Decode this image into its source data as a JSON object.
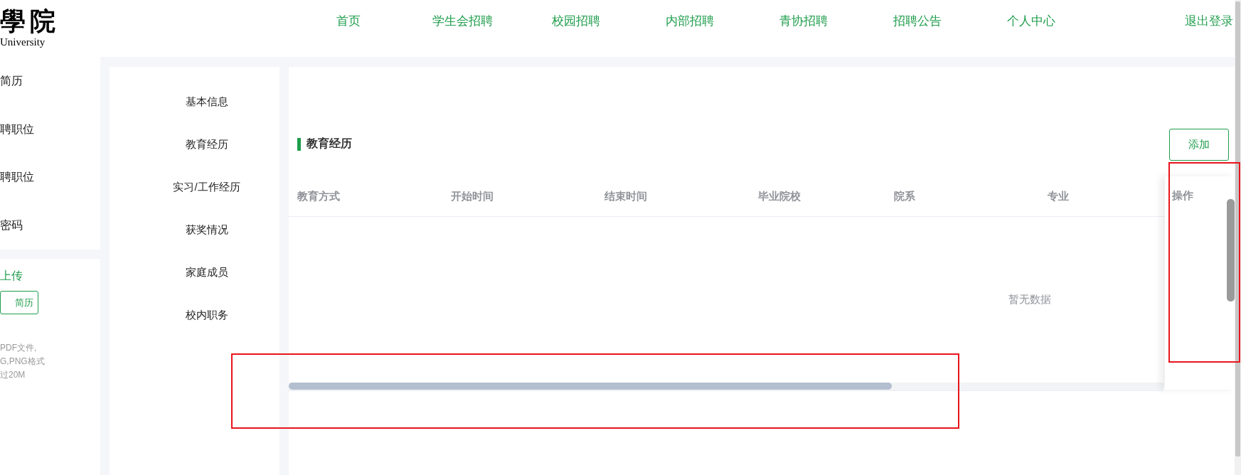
{
  "header": {
    "logo": {
      "mark": "學院",
      "subtitle": "University"
    },
    "nav": [
      {
        "label": "首页"
      },
      {
        "label": "学生会招聘"
      },
      {
        "label": "校园招聘"
      },
      {
        "label": "内部招聘"
      },
      {
        "label": "青协招聘"
      },
      {
        "label": "招聘公告"
      },
      {
        "label": "个人中心"
      }
    ],
    "logout": "退出登录"
  },
  "sidebar": {
    "items": [
      "简历",
      "聘职位",
      "聘职位",
      "密码"
    ],
    "upload": {
      "title": "上传",
      "button": "简历",
      "notes": [
        "PDF文件,",
        "G,PNG格式",
        "过20M"
      ]
    }
  },
  "section_nav": {
    "items": [
      "基本信息",
      "教育经历",
      "实习/工作经历",
      "获奖情况",
      "家庭成员",
      "校内职务"
    ]
  },
  "section": {
    "title": "教育经历",
    "add_button": "添加",
    "table": {
      "columns": [
        "教育方式",
        "开始时间",
        "结束时间",
        "毕业院校",
        "院系",
        "专业",
        "操作"
      ],
      "empty_text": "暂无数据"
    }
  },
  "annotations": [
    {
      "kind": "rectangle",
      "color": "#e8141c"
    },
    {
      "kind": "rectangle",
      "color": "#e8141c"
    }
  ]
}
